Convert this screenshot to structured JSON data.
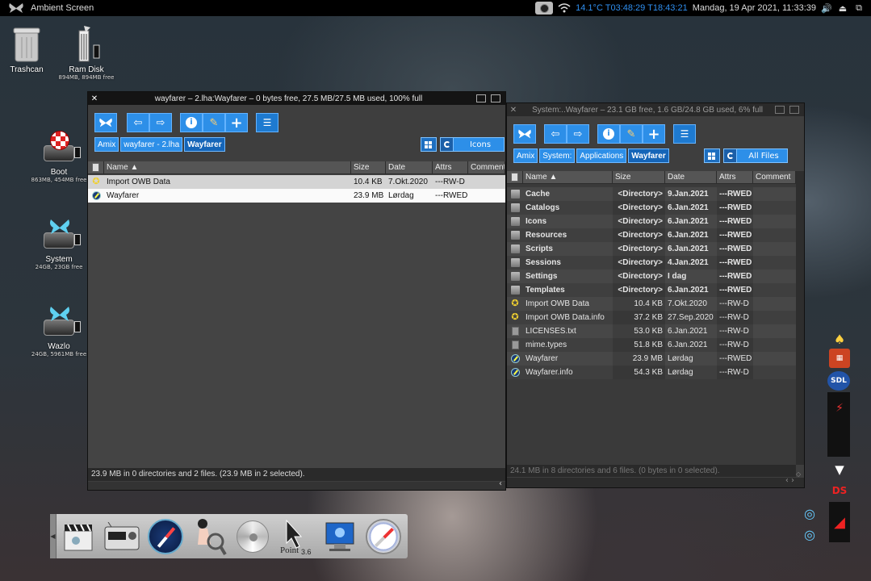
{
  "topbar": {
    "title": "Ambient Screen",
    "system_info": "14.1°C T03:48:29 T18:43:21",
    "clock": "Mandag, 19 Apr 2021, 11:33:39"
  },
  "desktop": {
    "icons": [
      {
        "label": "Trashcan",
        "sub": ""
      },
      {
        "label": "Ram Disk",
        "sub": "894MB, 894MB free"
      },
      {
        "label": "Boot",
        "sub": "863MB, 454MB free"
      },
      {
        "label": "System",
        "sub": "24GB, 23GB free"
      },
      {
        "label": "Wazlo",
        "sub": "24GB, 5961MB free"
      }
    ]
  },
  "left_window": {
    "title": "wayfarer – 2.lha:Wayfarer – 0 bytes free, 27.5 MB/27.5 MB used, 100% full",
    "crumbs": [
      "Amix",
      "wayfarer - 2.lha",
      "Wayfarer"
    ],
    "view_mode": "Icons",
    "columns": [
      "Name",
      "Size",
      "Date",
      "Attrs",
      "Comment"
    ],
    "rows": [
      {
        "icon": "star",
        "name": "Import OWB Data",
        "size": "10.4 KB",
        "date": "7.Okt.2020",
        "attrs": "---RW-D"
      },
      {
        "icon": "compass",
        "name": "Wayfarer",
        "size": "23.9 MB",
        "date": "Lørdag",
        "attrs": "---RWED"
      }
    ],
    "status": "23.9 MB in 0 directories and 2 files. (23.9 MB in 2 selected)."
  },
  "right_window": {
    "title": "System:..Wayfarer – 23.1 GB free, 1.6 GB/24.8 GB used, 6% full",
    "crumbs": [
      "Amix",
      "System:",
      "Applications",
      "Wayfarer"
    ],
    "view_mode": "All Files",
    "columns": [
      "Name",
      "Size",
      "Date",
      "Attrs",
      "Comment"
    ],
    "rows": [
      {
        "icon": "drawer",
        "name": "Cache",
        "size": "<Directory>",
        "date": "9.Jan.2021",
        "attrs": "---RWED",
        "dir": true
      },
      {
        "icon": "drawer",
        "name": "Catalogs",
        "size": "<Directory>",
        "date": "6.Jan.2021",
        "attrs": "---RWED",
        "dir": true
      },
      {
        "icon": "drawer",
        "name": "Icons",
        "size": "<Directory>",
        "date": "6.Jan.2021",
        "attrs": "---RWED",
        "dir": true
      },
      {
        "icon": "drawer",
        "name": "Resources",
        "size": "<Directory>",
        "date": "6.Jan.2021",
        "attrs": "---RWED",
        "dir": true
      },
      {
        "icon": "drawer",
        "name": "Scripts",
        "size": "<Directory>",
        "date": "6.Jan.2021",
        "attrs": "---RWED",
        "dir": true
      },
      {
        "icon": "drawer",
        "name": "Sessions",
        "size": "<Directory>",
        "date": "4.Jan.2021",
        "attrs": "---RWED",
        "dir": true
      },
      {
        "icon": "drawer",
        "name": "Settings",
        "size": "<Directory>",
        "date": "I dag",
        "attrs": "---RWED",
        "dir": true
      },
      {
        "icon": "drawer",
        "name": "Templates",
        "size": "<Directory>",
        "date": "6.Jan.2021",
        "attrs": "---RWED",
        "dir": true
      },
      {
        "icon": "star",
        "name": "Import OWB Data",
        "size": "10.4 KB",
        "date": "7.Okt.2020",
        "attrs": "---RW-D",
        "dir": false
      },
      {
        "icon": "star",
        "name": "Import OWB Data.info",
        "size": "37.2 KB",
        "date": "27.Sep.2020",
        "attrs": "---RW-D",
        "dir": false
      },
      {
        "icon": "doc",
        "name": "LICENSES.txt",
        "size": "53.0 KB",
        "date": "6.Jan.2021",
        "attrs": "---RW-D",
        "dir": false
      },
      {
        "icon": "doc",
        "name": "mime.types",
        "size": "51.8 KB",
        "date": "6.Jan.2021",
        "attrs": "---RW-D",
        "dir": false
      },
      {
        "icon": "compass",
        "name": "Wayfarer",
        "size": "23.9 MB",
        "date": "Lørdag",
        "attrs": "---RWED",
        "dir": false
      },
      {
        "icon": "compass",
        "name": "Wayfarer.info",
        "size": "54.3 KB",
        "date": "Lørdag",
        "attrs": "---RW-D",
        "dir": false
      }
    ],
    "status": "24.1 MB in 8 directories and 6 files. (0 bytes in 0 selected)."
  },
  "dock": {
    "apps": [
      "clapper-icon",
      "radio-icon",
      "compass-icon",
      "pinup-icon",
      "cd-icon",
      "pointer-icon",
      "monitor-icon",
      "safari-icon"
    ],
    "pointer_version": "3.6"
  },
  "colors": {
    "accent": "#2d8fe8",
    "panel": "#3e3e3e",
    "topbar": "#000000"
  }
}
